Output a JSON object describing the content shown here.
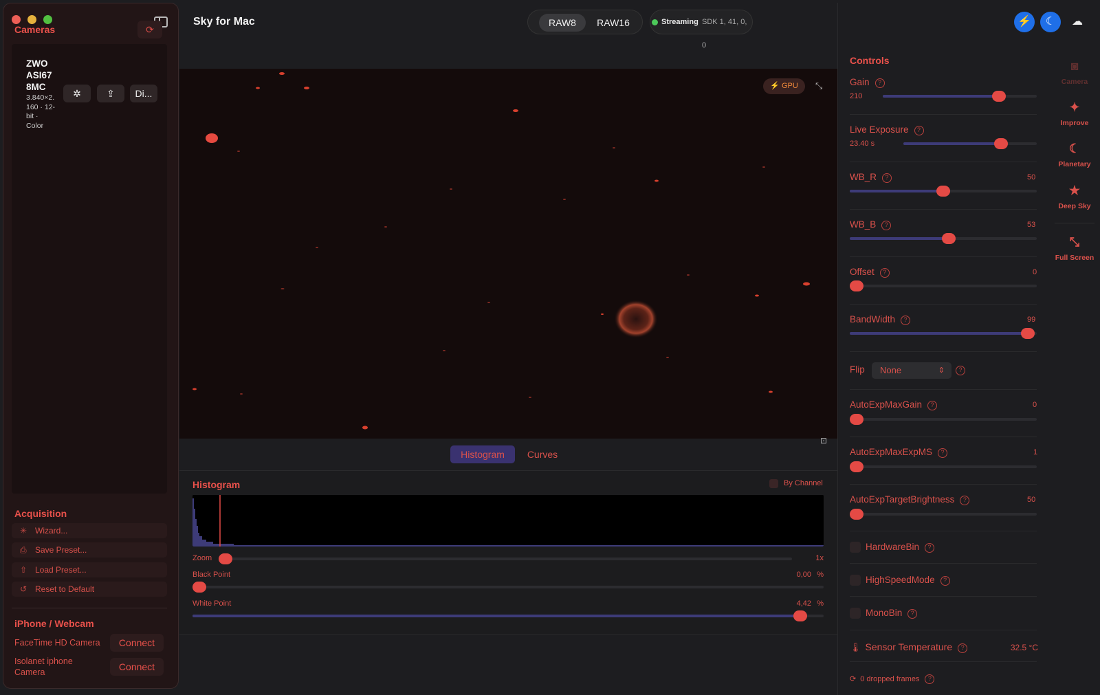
{
  "app": {
    "title": "Sky for Mac"
  },
  "sidebar": {
    "cameras_title": "Cameras",
    "camera": {
      "name": "ZWO ASI67 8MC",
      "name_lines": [
        "ZWO",
        "ASI67",
        "8MC"
      ],
      "specs_lines": [
        "3.840×2.",
        "160 · 12-",
        "bit ·",
        "Color"
      ],
      "display_button": "Di..."
    },
    "acquisition_title": "Acquisition",
    "acquisition_items": [
      {
        "label": "Wizard...",
        "icon": "wand-icon"
      },
      {
        "label": "Save Preset...",
        "icon": "save-icon"
      },
      {
        "label": "Load Preset...",
        "icon": "upload-icon"
      },
      {
        "label": "Reset to Default",
        "icon": "reset-icon"
      }
    ],
    "webcam_title": "iPhone / Webcam",
    "webcams": [
      {
        "name": "FaceTime HD Camera",
        "action": "Connect"
      },
      {
        "name_lines": [
          "Isolanet iphone",
          "Camera"
        ],
        "action": "Connect"
      }
    ]
  },
  "toolbar": {
    "formats": [
      "RAW8",
      "RAW16"
    ],
    "selected_format": "RAW8",
    "status": "Streaming",
    "sdk": "SDK 1, 41, 0, 0",
    "status_color": "#4cc95a"
  },
  "preview": {
    "gpu_badge": "GPU"
  },
  "view_tabs": {
    "tabs": [
      "Histogram",
      "Curves"
    ],
    "selected": "Histogram"
  },
  "histogram": {
    "title": "Histogram",
    "by_channel_label": "By Channel",
    "zoom": {
      "label": "Zoom",
      "value": "1x",
      "fraction": 0.0
    },
    "black_point": {
      "label": "Black Point",
      "value": "0,00",
      "unit": "%",
      "fraction": 0.0
    },
    "white_point": {
      "label": "White Point",
      "value": "4,42",
      "unit": "%",
      "fraction": 0.0442
    }
  },
  "controls": {
    "title": "Controls",
    "sliders": [
      {
        "label": "Gain",
        "value": "210",
        "fraction": 0.78
      },
      {
        "label": "Live Exposure",
        "value": "23.40 s",
        "fraction": 0.76
      },
      {
        "label": "WB_R",
        "value": "50",
        "fraction": 0.5
      },
      {
        "label": "WB_B",
        "value": "53",
        "fraction": 0.53
      },
      {
        "label": "Offset",
        "value": "0",
        "fraction": 0.0
      },
      {
        "label": "BandWidth",
        "value": "99",
        "fraction": 0.99
      }
    ],
    "flip": {
      "label": "Flip",
      "value": "None"
    },
    "auto_sliders": [
      {
        "label": "AutoExpMaxGain",
        "value": "0",
        "fraction": 0.0
      },
      {
        "label": "AutoExpMaxExpMS",
        "value": "1",
        "fraction": 0.0
      },
      {
        "label": "AutoExpTargetBrightness",
        "value": "50",
        "fraction": 0.0
      }
    ],
    "checkboxes": [
      "HardwareBin",
      "HighSpeedMode",
      "MonoBin"
    ],
    "sensor_temperature": {
      "label": "Sensor Temperature",
      "value": "32.5 °C"
    },
    "dropped_frames": "0 dropped frames"
  },
  "rail": {
    "items": [
      {
        "label": "Camera",
        "icon": "camera-icon"
      },
      {
        "label": "Improve",
        "icon": "sparkle-icon"
      },
      {
        "label": "Planetary",
        "icon": "moon-icon"
      },
      {
        "label": "Deep Sky",
        "icon": "star-icon"
      },
      {
        "label": "Full Screen",
        "icon": "fullscreen-icon"
      }
    ],
    "top_icons": [
      "bolt-icon",
      "night-mode-icon",
      "weather-icon"
    ]
  },
  "colors": {
    "accent": "#e9514b",
    "track_fill": "#3d3b78",
    "thumb": "#e44a45"
  }
}
